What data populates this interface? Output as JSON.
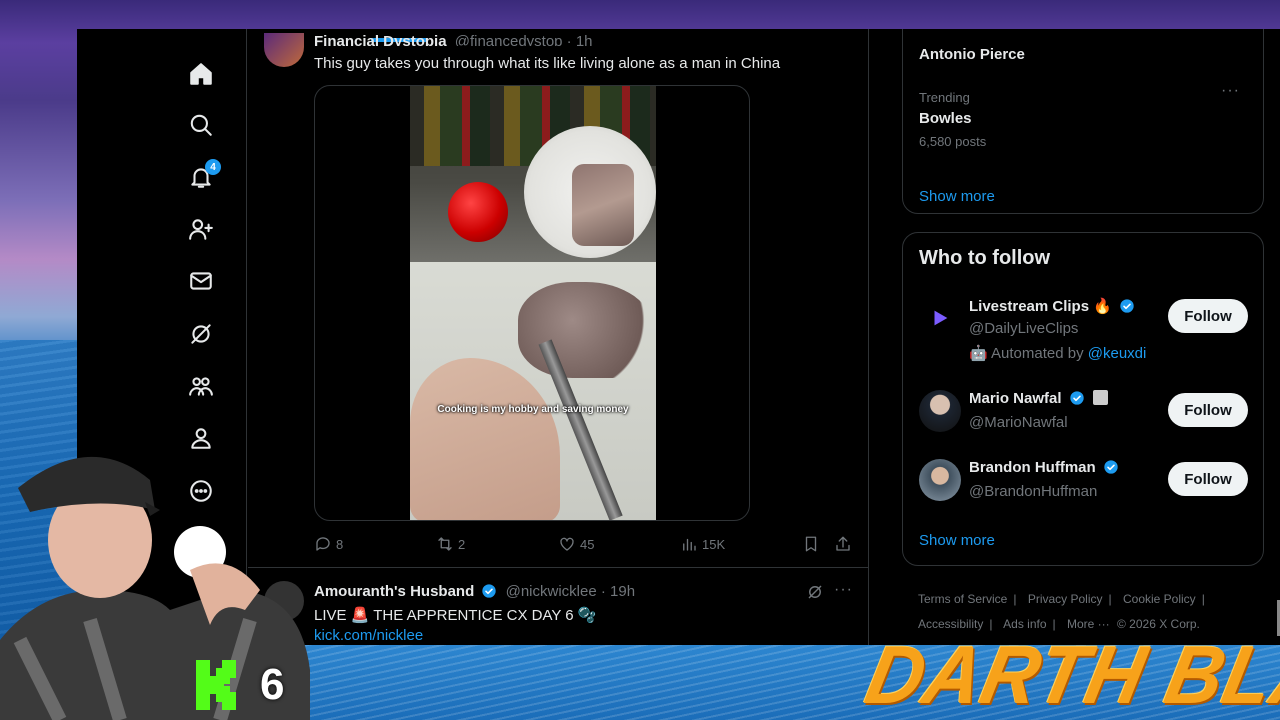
{
  "nav": {
    "notifications_count": "4"
  },
  "tweet1": {
    "author": "Financial Dystopia",
    "handle": "@financedystop · 1h",
    "text": "This guy takes you through what its like living alone as a man in China",
    "video_caption": "Cooking is my hobby and saving money",
    "replies": "8",
    "reposts": "2",
    "likes": "45",
    "views": "15K"
  },
  "tweet2": {
    "author": "Amouranth's Husband",
    "handle": "@nickwicklee · 19h",
    "text": "LIVE 🚨 THE APPRENTICE CX DAY 6 🫧",
    "link": "kick.com/nicklee"
  },
  "trends": {
    "previous_item": "Antonio Pierce",
    "label": "Trending",
    "name": "Bowles",
    "count": "6,580 posts",
    "show_more": "Show more"
  },
  "who_to_follow": {
    "title": "Who to follow",
    "accounts": [
      {
        "name": "Livestream Clips 🔥",
        "handle": "@DailyLiveClips",
        "note_prefix": "Automated by",
        "note_link": "@keuxdi",
        "button": "Follow"
      },
      {
        "name": "Mario Nawfal",
        "handle": "@MarioNawfal",
        "button": "Follow"
      },
      {
        "name": "Brandon Huffman",
        "handle": "@BrandonHuffman",
        "button": "Follow"
      }
    ],
    "show_more": "Show more"
  },
  "footer": {
    "links": [
      "Terms of Service",
      "Privacy Policy",
      "Cookie Policy",
      "Accessibility",
      "Ads info",
      "More ···"
    ],
    "copyright": "© 2026 X Corp."
  },
  "overlay": {
    "kick_number": "6",
    "brand": "DARTH BLAZE"
  },
  "colors": {
    "accent": "#1d9bf0",
    "brand_orange": "#f7a21a",
    "kick_green": "#53fc18"
  }
}
